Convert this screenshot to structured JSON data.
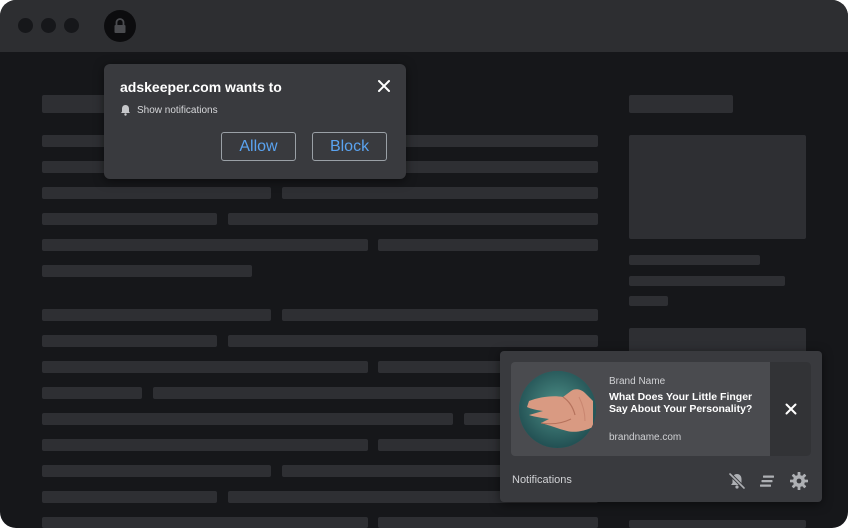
{
  "permission_popup": {
    "title": "adskeeper.com wants to",
    "permission_label": "Show notifications",
    "allow_label": "Allow",
    "block_label": "Block"
  },
  "notification": {
    "brand": "Brand Name",
    "headline": "What Does Your Little Finger Say About Your Personality?",
    "site": "brandname.com"
  },
  "notification_center": {
    "label": "Notifications"
  },
  "colors": {
    "page_background": "#16171a",
    "titlebar": "#2d2e31",
    "popup_background": "#393a3e",
    "button_text": "#5aa3f0"
  },
  "icons": [
    "lock-icon",
    "bell-icon",
    "close-icon",
    "bell-off-icon",
    "clear-all-icon",
    "gear-icon"
  ]
}
